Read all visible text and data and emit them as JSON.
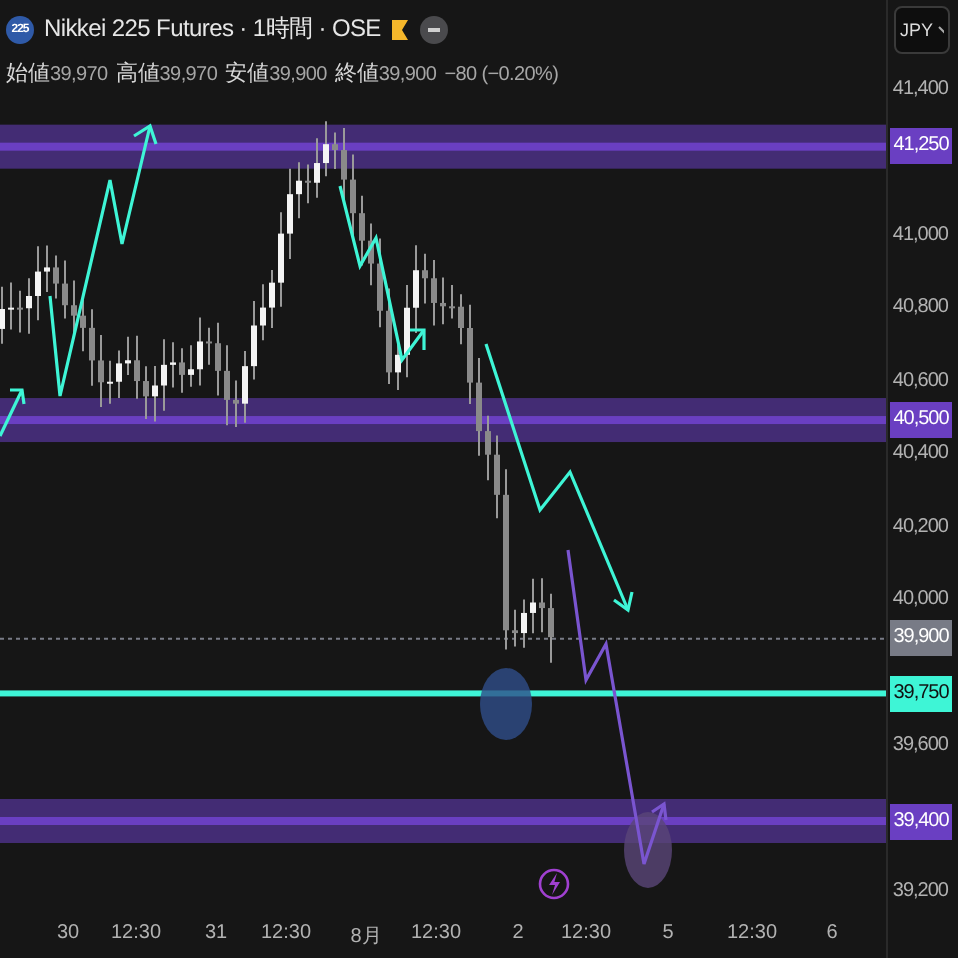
{
  "header": {
    "symbol_badge": "225",
    "title": "Nikkei 225 Futures · 1時間 · OSE",
    "ohlc": [
      {
        "label": "始値",
        "value": "39,970"
      },
      {
        "label": "高値",
        "value": "39,970"
      },
      {
        "label": "安値",
        "value": "39,900"
      },
      {
        "label": "終値",
        "value": "39,900"
      }
    ],
    "change": "−80 (−0.20%)"
  },
  "currency_button": "JPY",
  "price_levels": [
    {
      "kind": "zone",
      "price": "41,250",
      "color": "#6a3fc2"
    },
    {
      "kind": "zone",
      "price": "40,500",
      "color": "#6a3fc2"
    },
    {
      "kind": "current",
      "price": "39,900",
      "color": "#787b86"
    },
    {
      "kind": "line",
      "price": "39,750",
      "color": "#3ef5d6"
    },
    {
      "kind": "zone",
      "price": "39,400",
      "color": "#6a3fc2"
    }
  ],
  "y_axis": [
    "41,400",
    "41,000",
    "40,800",
    "40,600",
    "40,400",
    "40,200",
    "40,000",
    "39,600",
    "39,200"
  ],
  "x_axis": [
    "30",
    "12:30",
    "31",
    "12:30",
    "8月",
    "12:30",
    "2",
    "12:30",
    "5",
    "12:30",
    "6"
  ]
}
